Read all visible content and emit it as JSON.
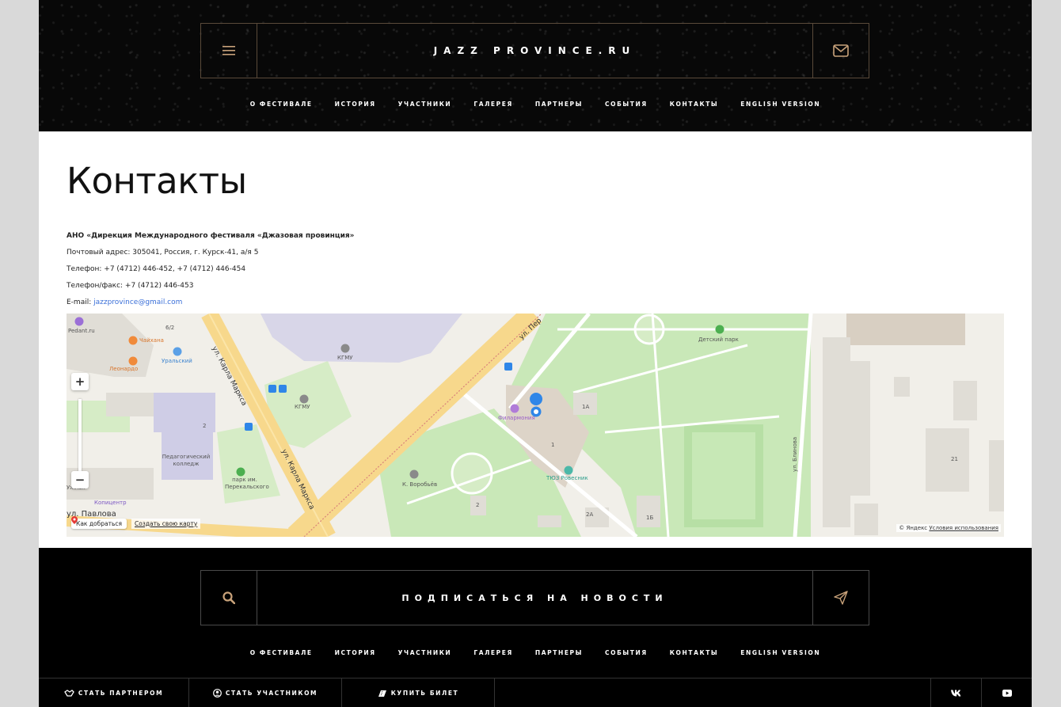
{
  "header": {
    "site_title": "JAZZ PROVINCE.RU",
    "nav": [
      "О ФЕСТИВАЛЕ",
      "ИСТОРИЯ",
      "УЧАСТНИКИ",
      "ГАЛЕРЕЯ",
      "ПАРТНЕРЫ",
      "СОБЫТИЯ",
      "КОНТАКТЫ",
      "ENGLISH VERSION"
    ]
  },
  "content": {
    "title": "Контакты",
    "org": "АНО «Дирекция Международного фестиваля «Джазовая провинция»",
    "address": "Почтовый адрес: 305041, Россия, г. Курск-41, а/я 5",
    "phone": "Телефон: +7 (4712) 446-452, +7 (4712) 446-454",
    "fax": "Телефон/факс: +7 (4712) 446-453",
    "email_label": "E-mail: ",
    "email": "jazzprovince@gmail.com"
  },
  "map": {
    "labels": {
      "pedant": "Pedant.ru",
      "chaikhana": "Чайхана",
      "leonardo": "Леонардо",
      "uralsky": "Уральский",
      "kgmu_top": "КГМУ",
      "kgmu_mid": "КГМУ",
      "num_6_2": "6/2",
      "num_2_left": "2",
      "num_1a": "1А",
      "num_1": "1",
      "num_2a": "2А",
      "num_1b": "1Б",
      "num_2_mid": "2",
      "num_21": "21",
      "ped_college": "Педагогический колледж",
      "park_perek": "парк им. Перекальского",
      "kopicentr": "Копицентр",
      "kopicentr_pre": "Ужная",
      "pavlova": "ул. Павлова",
      "karla_marksa_1": "ул. Карла Маркса",
      "karla_marksa_2": "ул. Карла Маркса",
      "ul_per": "ул. Пер",
      "filarmonia": "Филармония",
      "tuz": "ТЮЗ Ровесник",
      "vorobyev": "К. Воробьёв",
      "detsky_park": "Детский парк",
      "blinova": "ул. Блинова"
    },
    "route_button": "Как добраться",
    "create_map": "Создать свою карту",
    "copyright_prefix": "© Яндекс ",
    "copyright_terms": "Условия использования",
    "zoom_in": "+",
    "zoom_out": "−"
  },
  "footer": {
    "subscribe": "ПОДПИСАТЬСЯ НА НОВОСТИ",
    "nav": [
      "О ФЕСТИВАЛЕ",
      "ИСТОРИЯ",
      "УЧАСТНИКИ",
      "ГАЛЕРЕЯ",
      "ПАРТНЕРЫ",
      "СОБЫТИЯ",
      "КОНТАКТЫ",
      "ENGLISH VERSION"
    ],
    "partner": "СТАТЬ ПАРТНЕРОМ",
    "participant": "СТАТЬ УЧАСТНИКОМ",
    "ticket": "КУПИТЬ БИЛЕТ",
    "vk": "vk",
    "youtube": "youtube"
  },
  "colors": {
    "accent": "#c8a27a",
    "dark": "#000000",
    "link": "#3a6fd8"
  }
}
